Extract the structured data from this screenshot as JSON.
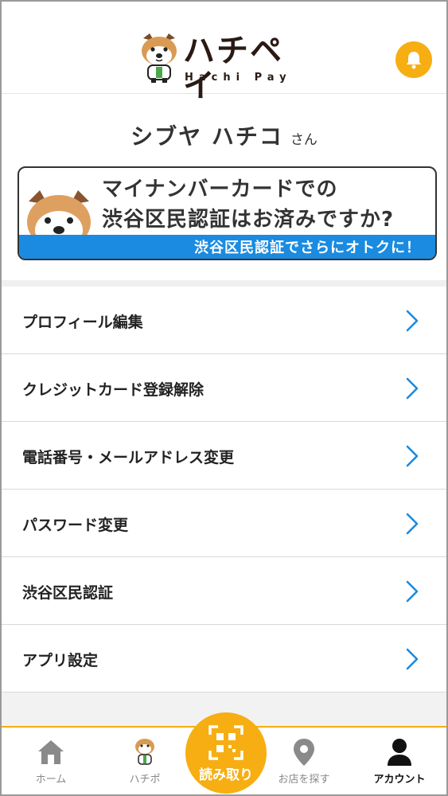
{
  "header": {
    "logo_text": "ハチペイ",
    "logo_subtext": "Hachi Pay",
    "bell_icon": "bell-icon",
    "accent_color": "#f6ae12"
  },
  "user": {
    "name": "シブヤ ハチコ",
    "suffix": "さん"
  },
  "banner": {
    "title_line1": "マイナンバーカードでの",
    "title_line2": "渋谷区民認証はお済みですか?",
    "strip_text": "渋谷区民認証でさらにオトクに！",
    "strip_color": "#1a8be0"
  },
  "menu": {
    "items": [
      {
        "label": "プロフィール編集"
      },
      {
        "label": "クレジットカード登録解除"
      },
      {
        "label": "電話番号・メールアドレス変更"
      },
      {
        "label": "パスワード変更"
      },
      {
        "label": "渋谷区民認証"
      },
      {
        "label": "アプリ設定"
      }
    ],
    "chevron_color": "#1a8be0"
  },
  "tabbar": {
    "home": "ホーム",
    "hachipo": "ハチポ",
    "scan": "読み取り",
    "stores": "お店を探す",
    "account": "アカウント",
    "active_tab": "アカウント"
  }
}
